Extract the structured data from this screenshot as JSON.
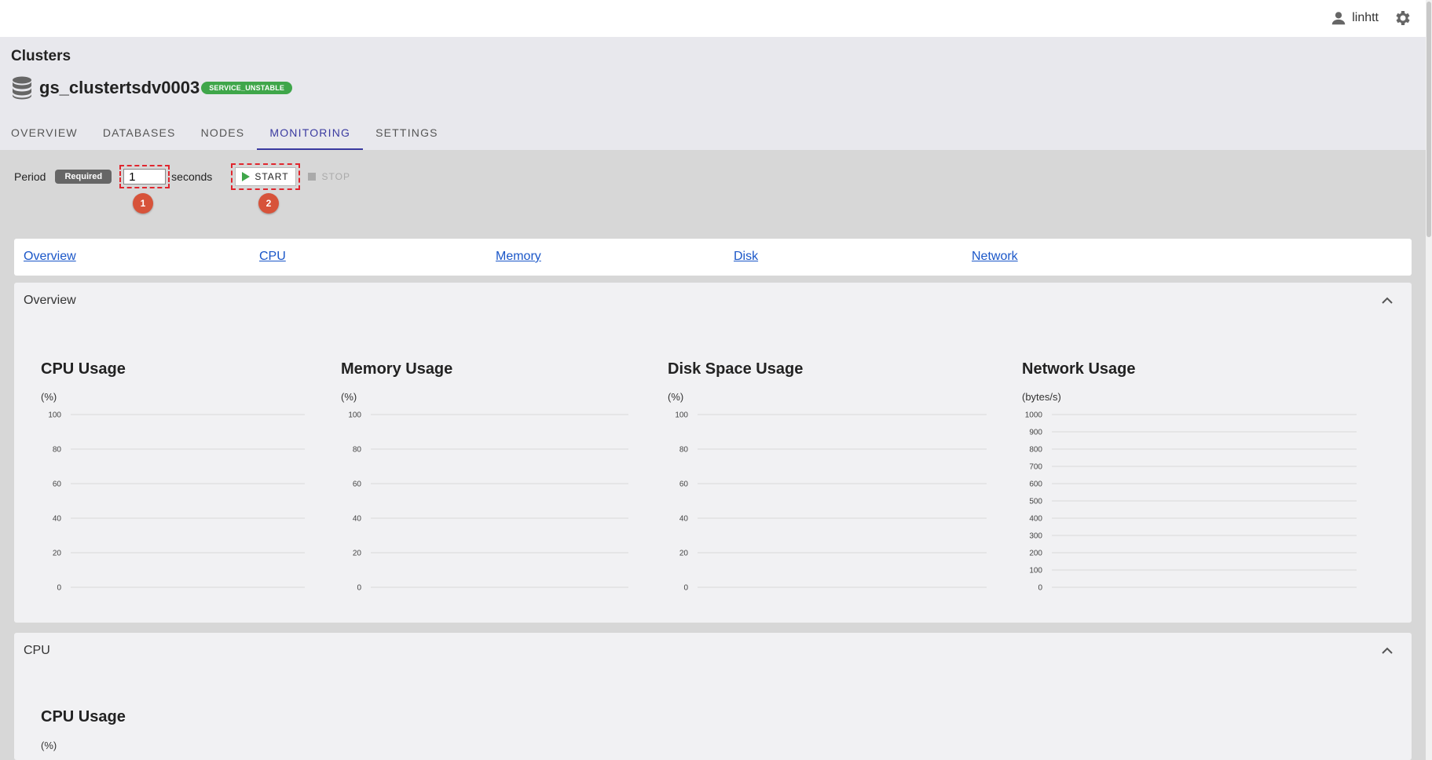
{
  "header": {
    "username": "linhtt",
    "breadcrumb": "Clusters",
    "cluster_name": "gs_clustertsdv0003",
    "status_badge": "SERVICE_UNSTABLE"
  },
  "tabs": [
    "OVERVIEW",
    "DATABASES",
    "NODES",
    "MONITORING",
    "SETTINGS"
  ],
  "active_tab": "MONITORING",
  "controls": {
    "period_label": "Period",
    "required_label": "Required",
    "period_value": "1",
    "unit_label": "seconds",
    "start_label": "START",
    "stop_label": "STOP",
    "marker_1": "1",
    "marker_2": "2"
  },
  "section_links": [
    "Overview",
    "CPU",
    "Memory",
    "Disk",
    "Network"
  ],
  "overview_panel": {
    "title": "Overview"
  },
  "cpu_panel": {
    "title": "CPU"
  },
  "colors": {
    "accent": "#3a3aa0",
    "success": "#3fa64a",
    "marker": "#d7533a",
    "link": "#1a56c8"
  },
  "chart_data": [
    {
      "type": "line",
      "title": "CPU Usage",
      "ylabel": "(%)",
      "ylim": [
        0,
        100
      ],
      "yticks": [
        0,
        20,
        40,
        60,
        80,
        100
      ],
      "series": [],
      "grid": true
    },
    {
      "type": "line",
      "title": "Memory Usage",
      "ylabel": "(%)",
      "ylim": [
        0,
        100
      ],
      "yticks": [
        0,
        20,
        40,
        60,
        80,
        100
      ],
      "series": [],
      "grid": true
    },
    {
      "type": "line",
      "title": "Disk Space Usage",
      "ylabel": "(%)",
      "ylim": [
        0,
        100
      ],
      "yticks": [
        0,
        20,
        40,
        60,
        80,
        100
      ],
      "series": [],
      "grid": true
    },
    {
      "type": "line",
      "title": "Network Usage",
      "ylabel": "(bytes/s)",
      "ylim": [
        0,
        1000
      ],
      "yticks": [
        0,
        100,
        200,
        300,
        400,
        500,
        600,
        700,
        800,
        900,
        1000
      ],
      "series": [],
      "grid": true
    },
    {
      "type": "line",
      "title": "CPU Usage",
      "ylabel": "(%)",
      "ylim": [
        0,
        100
      ],
      "series": []
    }
  ]
}
